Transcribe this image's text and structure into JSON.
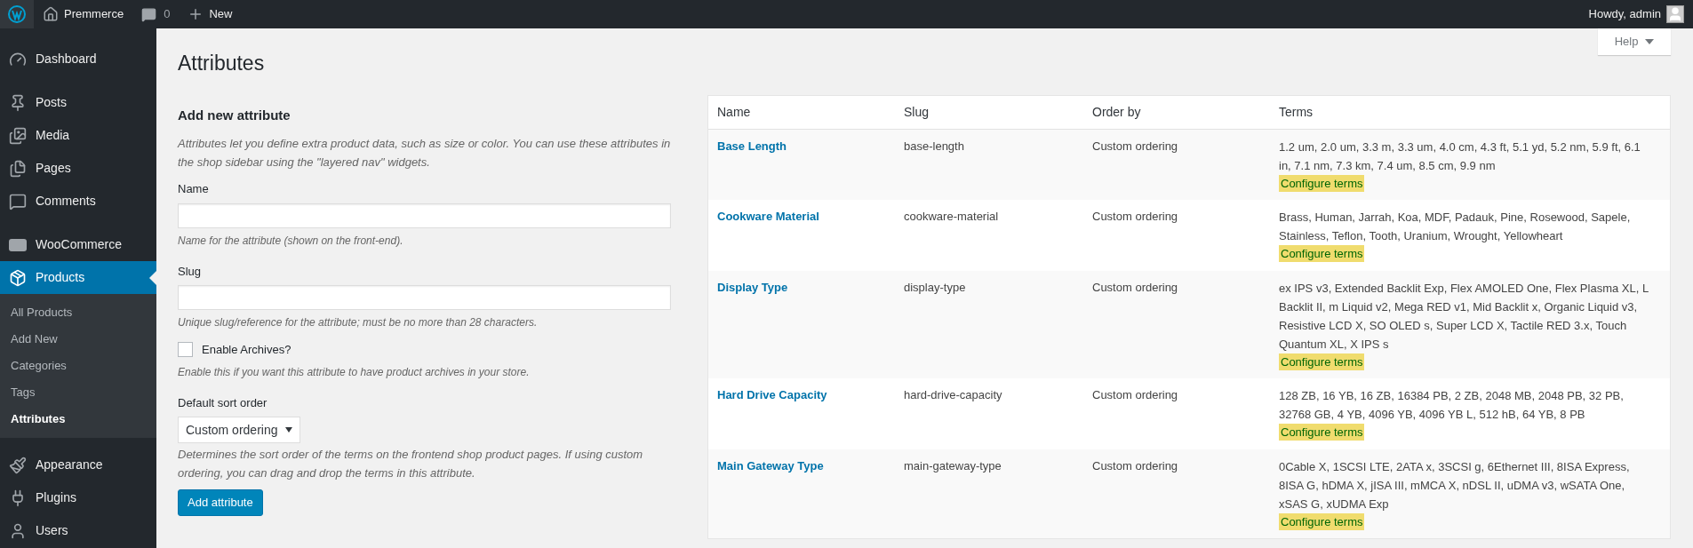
{
  "admin_bar": {
    "site_name": "Premmerce",
    "comments_count": "0",
    "new_label": "New",
    "greeting": "Howdy, admin"
  },
  "sidebar": {
    "items": [
      {
        "label": "Dashboard",
        "selected": false
      },
      {
        "label": "Posts",
        "selected": false
      },
      {
        "label": "Media",
        "selected": false
      },
      {
        "label": "Pages",
        "selected": false
      },
      {
        "label": "Comments",
        "selected": false
      },
      {
        "label": "WooCommerce",
        "selected": false
      },
      {
        "label": "Products",
        "selected": true,
        "children": [
          {
            "label": "All Products",
            "selected": false
          },
          {
            "label": "Add New",
            "selected": false
          },
          {
            "label": "Categories",
            "selected": false
          },
          {
            "label": "Tags",
            "selected": false
          },
          {
            "label": "Attributes",
            "selected": true
          }
        ]
      },
      {
        "label": "Appearance",
        "selected": false
      },
      {
        "label": "Plugins",
        "selected": false
      },
      {
        "label": "Users",
        "selected": false
      }
    ]
  },
  "help_button": "Help",
  "page_title": "Attributes",
  "form": {
    "title": "Add new attribute",
    "intro": "Attributes let you define extra product data, such as size or color. You can use these attributes in the shop sidebar using the \"layered nav\" widgets.",
    "name_label": "Name",
    "name_hint": "Name for the attribute (shown on the front-end).",
    "slug_label": "Slug",
    "slug_hint": "Unique slug/reference for the attribute; must be no more than 28 characters.",
    "archives_label": "Enable Archives?",
    "archives_checked": false,
    "archives_hint": "Enable this if you want this attribute to have product archives in your store.",
    "sort_label": "Default sort order",
    "sort_value": "Custom ordering",
    "sort_hint": "Determines the sort order of the terms on the frontend shop product pages. If using custom ordering, you can drag and drop the terms in this attribute.",
    "submit": "Add attribute"
  },
  "table": {
    "columns": [
      "Name",
      "Slug",
      "Order by",
      "Terms"
    ],
    "rows": [
      {
        "name": "Base Length",
        "slug": "base-length",
        "order_by": "Custom ordering",
        "terms": "1.2 um, 2.0 um, 3.3 m, 3.3 um, 4.0 cm, 4.3 ft, 5.1 yd, 5.2 nm, 5.9 ft, 6.1 in, 7.1 nm, 7.3 km, 7.4 um, 8.5 cm, 9.9 nm",
        "configure": "Configure terms"
      },
      {
        "name": "Cookware Material",
        "slug": "cookware-material",
        "order_by": "Custom ordering",
        "terms": "Brass, Human, Jarrah, Koa, MDF, Padauk, Pine, Rosewood, Sapele, Stainless, Teflon, Tooth, Uranium, Wrought, Yellowheart",
        "configure": "Configure terms"
      },
      {
        "name": "Display Type",
        "slug": "display-type",
        "order_by": "Custom ordering",
        "terms": "ex IPS v3, Extended Backlit Exp, Flex AMOLED One, Flex Plasma XL, L Backlit II, m Liquid v2, Mega RED v1, Mid Backlit x, Organic Liquid v3, Resistive LCD X, SO OLED s, Super LCD X, Tactile RED 3.x, Touch Quantum XL, X IPS s",
        "configure": "Configure terms"
      },
      {
        "name": "Hard Drive Capacity",
        "slug": "hard-drive-capacity",
        "order_by": "Custom ordering",
        "terms": "128 ZB, 16 YB, 16 ZB, 16384 PB, 2 ZB, 2048 MB, 2048 PB, 32 PB, 32768 GB, 4 YB, 4096 YB, 4096 YB L, 512 hB, 64 YB, 8 PB",
        "configure": "Configure terms"
      },
      {
        "name": "Main Gateway Type",
        "slug": "main-gateway-type",
        "order_by": "Custom ordering",
        "terms": "0Cable X, 1SCSI LTE, 2ATA x, 3SCSI g, 6Ethernet III, 8ISA Express, 8ISA G, hDMA X, jISA III, mMCA X, nDSL II, uDMA v3, wSATA One, xSAS G, xUDMA Exp",
        "configure": "Configure terms"
      }
    ]
  }
}
